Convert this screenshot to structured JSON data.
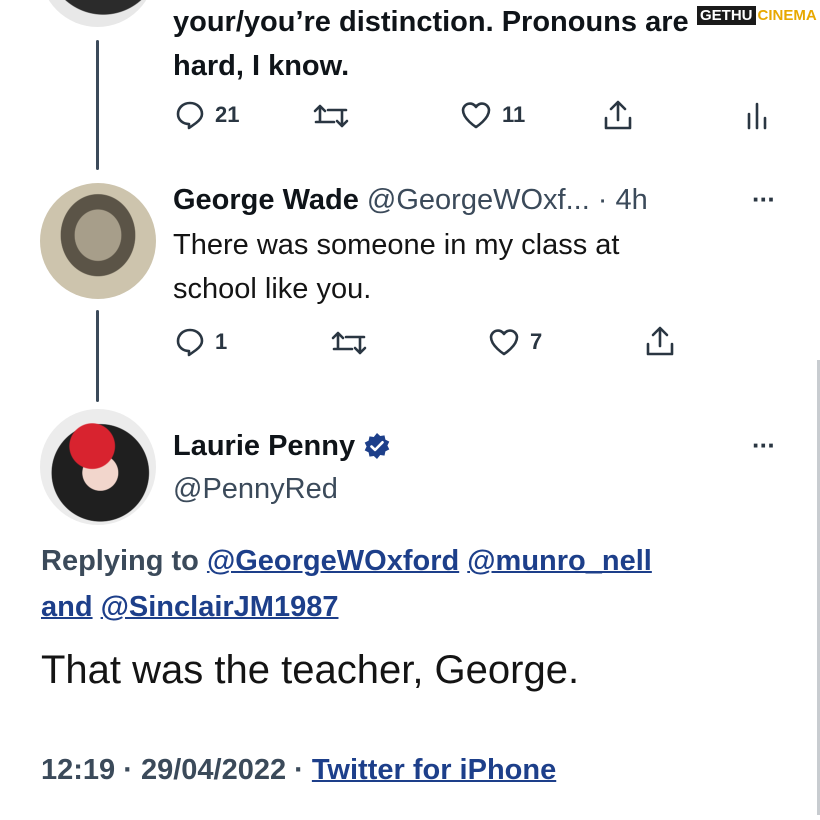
{
  "tweet1": {
    "text_line1": "your/you’re distinction. Pronouns are",
    "text_line2": "hard, I know.",
    "reply_count": "21",
    "like_count": "11"
  },
  "watermark": {
    "text": "GETHU",
    "text2": "CINEMA"
  },
  "tweet2": {
    "name": "George Wade",
    "handle_time": "@GeorgeWOxf... · 4h",
    "text_line1": "There was someone in my class at",
    "text_line2": "school like you.",
    "reply_count": "1",
    "like_count": "7",
    "more_label": "···"
  },
  "main_tweet": {
    "name": "Laurie Penny",
    "handle": "@PennyRed",
    "more_label": "···",
    "replying_to_label": "Replying to",
    "reply_mention_1": "@GeorgeWOxford",
    "reply_mention_2": "@munro_nell",
    "reply_and": "and",
    "reply_mention_3": "@SinclairJM1987",
    "text": "That was the teacher, George.",
    "time_date": "12:19 · 29/04/2022 ·",
    "source": "Twitter for iPhone"
  },
  "colors": {
    "verified": "#1d9bf0",
    "link": "#1d3f8a",
    "thread_line": "#3b4a5a"
  }
}
